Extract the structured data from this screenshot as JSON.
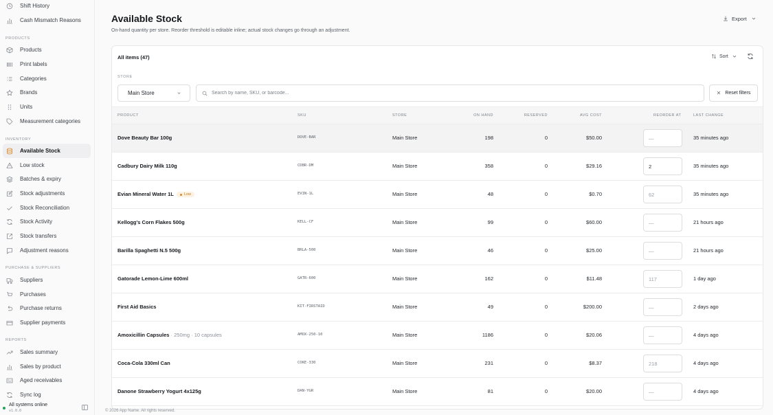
{
  "sidebar": {
    "top_items": [
      {
        "label": "Shift History",
        "icon": "clock-icon"
      },
      {
        "label": "Cash Mismatch Reasons",
        "icon": "bar-chart-icon"
      }
    ],
    "sections": [
      {
        "label": "PRODUCTS",
        "items": [
          {
            "label": "Products",
            "icon": "box-icon"
          },
          {
            "label": "Print labels",
            "icon": "barcode-icon"
          },
          {
            "label": "Categories",
            "icon": "list-icon"
          },
          {
            "label": "Brands",
            "icon": "star-icon"
          },
          {
            "label": "Units",
            "icon": "grip-icon"
          },
          {
            "label": "Measurement categories",
            "icon": "tag-icon"
          }
        ]
      },
      {
        "label": "INVENTORY",
        "items": [
          {
            "label": "Available Stock",
            "icon": "database-icon",
            "active": true
          },
          {
            "label": "Low stock",
            "icon": "warning-icon"
          },
          {
            "label": "Batches & expiry",
            "icon": "layers-icon"
          },
          {
            "label": "Stock adjustments",
            "icon": "edit-icon"
          },
          {
            "label": "Stock Reconciliation",
            "icon": "check-icon"
          },
          {
            "label": "Stock Activity",
            "icon": "refresh-icon"
          },
          {
            "label": "Stock transfers",
            "icon": "external-icon"
          },
          {
            "label": "Adjustment reasons",
            "icon": "message-icon"
          }
        ]
      },
      {
        "label": "PURCHASE & SUPPLIERS",
        "items": [
          {
            "label": "Suppliers",
            "icon": "truck-icon"
          },
          {
            "label": "Purchases",
            "icon": "cart-icon"
          },
          {
            "label": "Purchase returns",
            "icon": "undo-icon"
          },
          {
            "label": "Supplier payments",
            "icon": "card-icon"
          }
        ]
      },
      {
        "label": "REPORTS",
        "items": [
          {
            "label": "Sales summary",
            "icon": "trend-icon"
          },
          {
            "label": "Sales by product",
            "icon": "bar-chart-icon"
          },
          {
            "label": "Aged receivables",
            "icon": "receipt-icon"
          },
          {
            "label": "Sync log",
            "icon": "refresh-icon"
          }
        ]
      }
    ],
    "status": {
      "text": "All systems online",
      "version": "v1.0.0"
    }
  },
  "header": {
    "title": "Available Stock",
    "subtitle": "On-hand quantity per store. Reorder threshold is editable inline; actual stock changes go through an adjustment.",
    "export_label": "Export"
  },
  "card": {
    "title": "All items (47)",
    "sort_label": "Sort",
    "store_label": "STORE",
    "store_value": "Main Store",
    "search_placeholder": "Search by name, SKU, or barcode...",
    "reset_label": "Reset filters"
  },
  "table": {
    "columns": [
      "PRODUCT",
      "SKU",
      "STORE",
      "ON HAND",
      "RESERVED",
      "AVG COST",
      "REORDER AT",
      "LAST CHANGE"
    ],
    "rows": [
      {
        "product": "Dove Beauty Bar 100g",
        "variant": "",
        "badge": "",
        "sku": "DOVE-BAR",
        "store": "Main Store",
        "on_hand": "198",
        "reserved": "0",
        "avg_cost": "$50.00",
        "reorder_value": "",
        "reorder_placeholder": "—",
        "last_change": "35 minutes ago"
      },
      {
        "product": "Cadbury Dairy Milk 110g",
        "variant": "",
        "badge": "",
        "sku": "CDBR-DM",
        "store": "Main Store",
        "on_hand": "358",
        "reserved": "0",
        "avg_cost": "$29.16",
        "reorder_value": "2",
        "reorder_placeholder": "",
        "last_change": "35 minutes ago"
      },
      {
        "product": "Evian Mineral Water 1L",
        "variant": "",
        "badge": "Low",
        "sku": "EVIN-1L",
        "store": "Main Store",
        "on_hand": "48",
        "reserved": "0",
        "avg_cost": "$0.70",
        "reorder_value": "",
        "reorder_placeholder": "62",
        "last_change": "35 minutes ago"
      },
      {
        "product": "Kellogg's Corn Flakes 500g",
        "variant": "",
        "badge": "",
        "sku": "KELL-CF",
        "store": "Main Store",
        "on_hand": "99",
        "reserved": "0",
        "avg_cost": "$60.00",
        "reorder_value": "",
        "reorder_placeholder": "—",
        "last_change": "21 hours ago"
      },
      {
        "product": "Barilla Spaghetti N.5 500g",
        "variant": "",
        "badge": "",
        "sku": "BRLA-500",
        "store": "Main Store",
        "on_hand": "46",
        "reserved": "0",
        "avg_cost": "$25.00",
        "reorder_value": "",
        "reorder_placeholder": "—",
        "last_change": "21 hours ago"
      },
      {
        "product": "Gatorade Lemon-Lime 600ml",
        "variant": "",
        "badge": "",
        "sku": "GATR-600",
        "store": "Main Store",
        "on_hand": "162",
        "reserved": "0",
        "avg_cost": "$11.48",
        "reorder_value": "",
        "reorder_placeholder": "117",
        "last_change": "1 day ago"
      },
      {
        "product": "First Aid Basics",
        "variant": "",
        "badge": "",
        "sku": "KIT-FIRSTAID",
        "store": "Main Store",
        "on_hand": "49",
        "reserved": "0",
        "avg_cost": "$200.00",
        "reorder_value": "",
        "reorder_placeholder": "—",
        "last_change": "2 days ago"
      },
      {
        "product": "Amoxicillin Capsules",
        "variant": " · 250mg · 10 capsules",
        "badge": "",
        "sku": "AMOX-250-10",
        "store": "Main Store",
        "on_hand": "1186",
        "reserved": "0",
        "avg_cost": "$20.06",
        "reorder_value": "",
        "reorder_placeholder": "—",
        "last_change": "4 days ago"
      },
      {
        "product": "Coca-Cola 330ml Can",
        "variant": "",
        "badge": "",
        "sku": "COKE-330",
        "store": "Main Store",
        "on_hand": "231",
        "reserved": "0",
        "avg_cost": "$8.37",
        "reorder_value": "",
        "reorder_placeholder": "218",
        "last_change": "4 days ago"
      },
      {
        "product": "Danone Strawberry Yogurt 4x125g",
        "variant": "",
        "badge": "",
        "sku": "DAN-YGR",
        "store": "Main Store",
        "on_hand": "81",
        "reserved": "0",
        "avg_cost": "$20.00",
        "reorder_value": "",
        "reorder_placeholder": "—",
        "last_change": "4 days ago"
      }
    ]
  },
  "footer": {
    "text": "© 2026 App Name. All rights reserved."
  },
  "colors": {
    "accent": "#d88a2a",
    "online": "#22a35a",
    "badge_bg": "#fdf1e1"
  }
}
